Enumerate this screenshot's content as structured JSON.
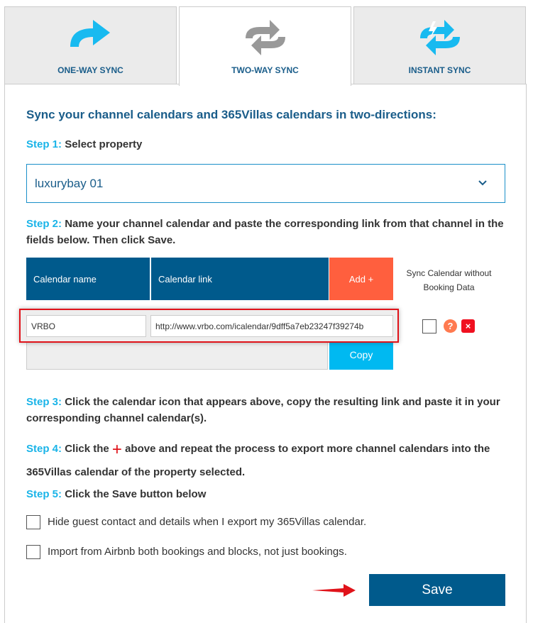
{
  "tabs": [
    {
      "label": "ONE-WAY SYNC",
      "icon": "arrow-right-curve-icon"
    },
    {
      "label": "TWO-WAY SYNC",
      "icon": "sync-arrows-icon",
      "active": true
    },
    {
      "label": "INSTANT SYNC",
      "icon": "instant-sync-icon"
    }
  ],
  "heading": "Sync your channel calendars and 365Villas calendars in two-directions:",
  "step1": {
    "label": "Step 1:",
    "text": "Select property"
  },
  "property_select": {
    "value": "luxurybay 01"
  },
  "step2": {
    "label": "Step 2:",
    "text": "Name your channel calendar and paste the corresponding link from that channel in the fields below. Then click Save."
  },
  "table": {
    "col_name": "Calendar name",
    "col_link": "Calendar link",
    "add_label": "Add +",
    "sync_without_label": "Sync Calendar without Booking Data",
    "row": {
      "name": "VRBO",
      "link": "http://www.vrbo.com/icalendar/9dff5a7eb23247f39274b"
    },
    "copy_label": "Copy"
  },
  "step3": {
    "label": "Step 3:",
    "text": "Click the calendar icon that appears above, copy the resulting link and paste it in your corresponding channel calendar(s)."
  },
  "step4": {
    "label": "Step 4:",
    "text_a": "Click the",
    "plus": "+",
    "text_b": "above and repeat the process to export more channel calendars into the 365Villas calendar of the property selected."
  },
  "step5": {
    "label": "Step 5:",
    "text": "Click the Save button below"
  },
  "options": [
    "Hide guest contact and details when I export my 365Villas calendar.",
    "Import from Airbnb both bookings and blocks, not just bookings."
  ],
  "save_label": "Save",
  "colors": {
    "primary": "#005a8c",
    "accent": "#1ab4e8",
    "add": "#ff5f3e",
    "highlight": "#e0131a"
  }
}
